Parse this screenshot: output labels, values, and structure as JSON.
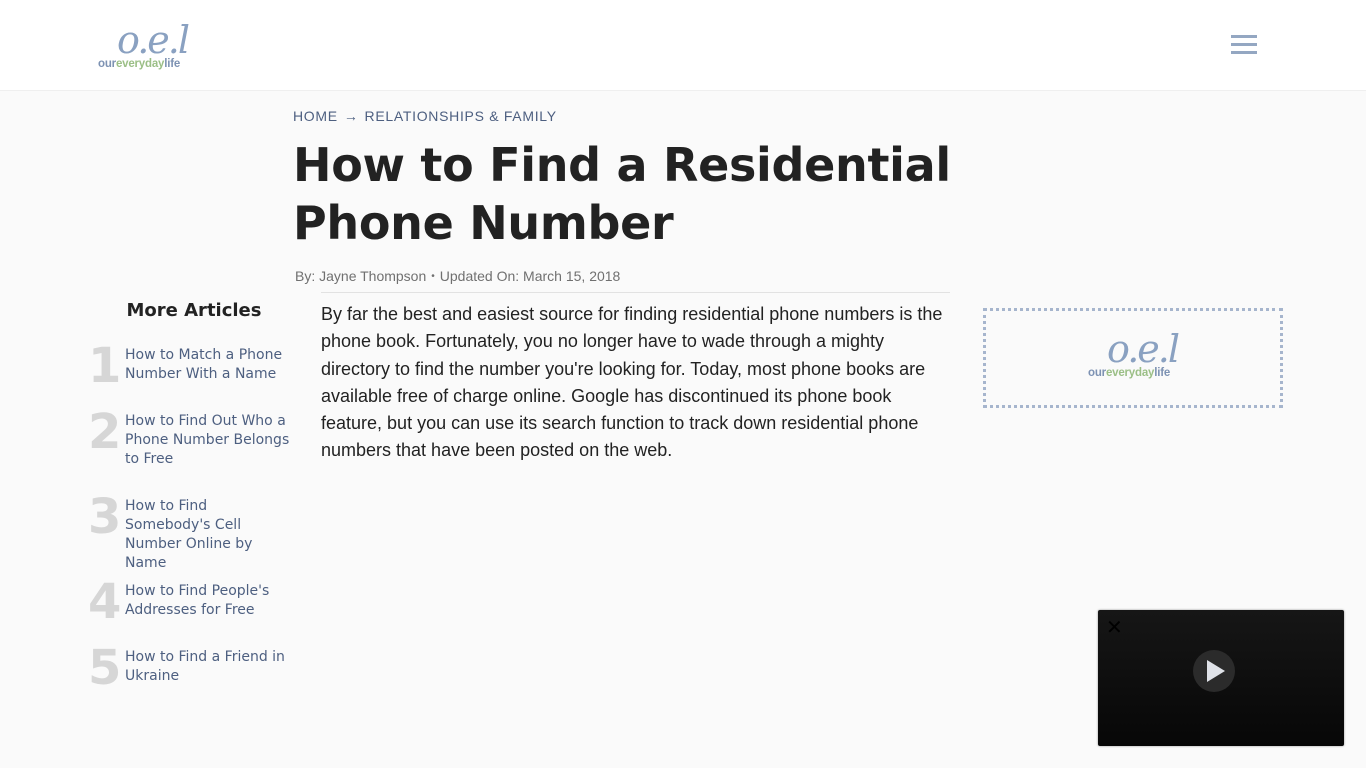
{
  "header": {
    "logo": {
      "mark": "o.e.l",
      "word_part1": "our",
      "word_part2": "everyday",
      "word_part3": "life"
    },
    "menu_icon": "hamburger-menu-icon"
  },
  "breadcrumb": {
    "items": [
      "HOME",
      "RELATIONSHIPS & FAMILY"
    ],
    "separator": "→"
  },
  "article": {
    "title": "How to Find a Residential Phone Number",
    "byline_author": "By: Jayne Thompson",
    "byline_separator": "•",
    "byline_updated": "Updated On: March 15, 2018",
    "body": "By far the best and easiest source for finding residential phone numbers is the phone book. Fortunately, you no longer have to wade through a mighty directory to find the number you're looking for. Today, most phone books are available free of charge online. Google has discontinued its phone book feature, but you can use its search function to track down residential phone numbers that have been posted on the web."
  },
  "more_articles": {
    "title": "More Articles",
    "items": [
      {
        "num": "1",
        "label": "How to Match a Phone Number With a Name"
      },
      {
        "num": "2",
        "label": "How to Find Out Who a Phone Number Belongs to Free"
      },
      {
        "num": "3",
        "label": "How to Find Somebody's Cell Number Online by Name"
      },
      {
        "num": "4",
        "label": "How to Find People's Addresses for Free"
      },
      {
        "num": "5",
        "label": "How to Find a Friend in Ukraine"
      }
    ]
  },
  "ad": {
    "logo": {
      "mark": "o.e.l",
      "word_part1": "our",
      "word_part2": "everyday",
      "word_part3": "life"
    }
  },
  "video": {
    "close_glyph": "✕",
    "play_icon": "play-icon"
  },
  "colors": {
    "link": "#4d5f80",
    "logo_blue": "#8aa1c1",
    "logo_green": "#9bbf86",
    "number_gray": "#d6d6d6"
  }
}
